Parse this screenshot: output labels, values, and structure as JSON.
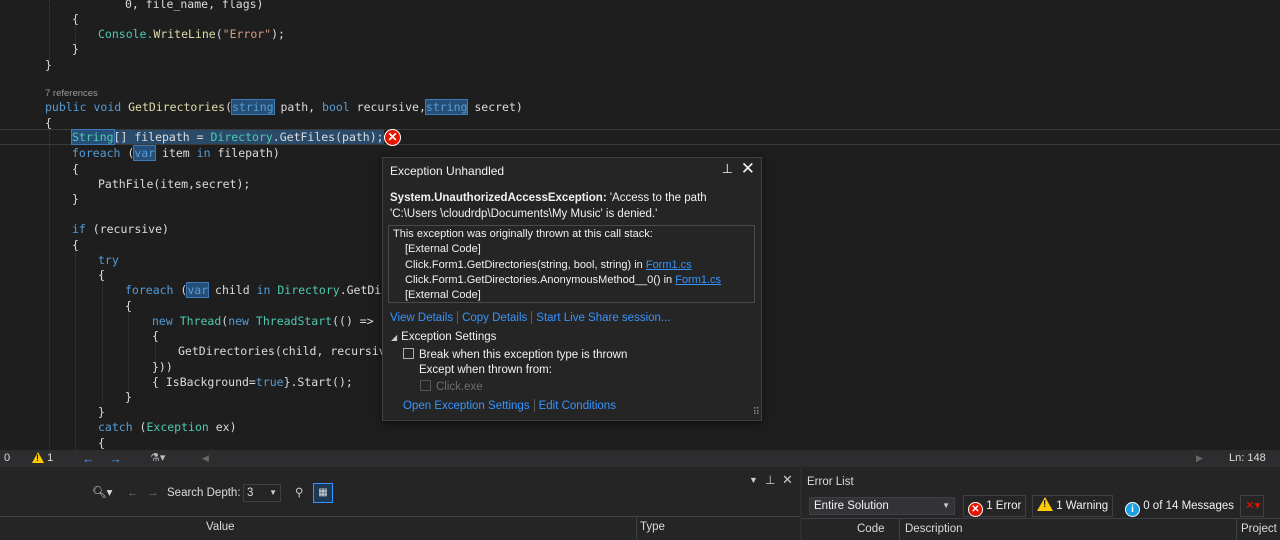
{
  "editor": {
    "lines": {
      "l0": "0, file_name, flags)",
      "brace_open1": "{",
      "console_call": "Console.",
      "console_method": "WriteLine",
      "console_arg": "\"Error\"",
      "console_end": ");",
      "brace_close1": "}",
      "brace_close2": "}",
      "refs": "7 references",
      "sig_public": "public",
      "sig_void": "void",
      "sig_name": "GetDirectories",
      "sig_p1type": "string",
      "sig_p1": " path, ",
      "sig_bool": "bool",
      "sig_p2": " recursive,",
      "sig_p3type": "string",
      "sig_p3": " secret)",
      "body_open": "{",
      "cur_type": "String",
      "cur_rest": "[] filepath = ",
      "cur_class": "Directory",
      "cur_call": ".GetFiles(path);",
      "foreach1_kw": "foreach",
      "foreach1_var": "var",
      "foreach1_rest": " item ",
      "foreach1_in": "in",
      "foreach1_end": " filepath)",
      "brace_open2": "{",
      "pathfile": "PathFile(item,secret);",
      "brace_close3": "}",
      "if_kw": "if",
      "if_rest": " (recursive)",
      "brace_open3": "{",
      "try_kw": "try",
      "brace_open4": "{",
      "foreach2_kw": "foreach",
      "foreach2_var": "var",
      "foreach2_rest": " child ",
      "foreach2_in": "in",
      "foreach2_class": " Directory",
      "foreach2_call": ".GetDir",
      "brace_open5": "{",
      "new_kw": "new",
      "thread": "Thread",
      "new2_kw": "new",
      "threadstart": "ThreadStart",
      "lambda": "(() =>",
      "brace_open6": "{",
      "getdir_call": "GetDirectories(child, recursiv",
      "close_lambda": "}))",
      "isbg_open": "{ IsBackground=",
      "isbg_true": "true",
      "isbg_end": "}.Start();",
      "brace_close4": "}",
      "brace_close5": "}",
      "catch_kw": "catch",
      "catch_type": "Exception",
      "catch_var": " ex",
      "catch_end": ")",
      "brace_open7": "{"
    }
  },
  "popup": {
    "title": "Exception Unhandled",
    "exception_type": "System.UnauthorizedAccessException:",
    "exception_message": " 'Access to the path 'C:\\Users \\cloudrdp\\Documents\\My Music' is denied.'",
    "callstack_header": "This exception was originally thrown at this call stack:",
    "frames": [
      {
        "text": "[External Code]",
        "link": ""
      },
      {
        "text": "Click.Form1.GetDirectories(string, bool, string) in ",
        "link": "Form1.cs"
      },
      {
        "text": "Click.Form1.GetDirectories.AnonymousMethod__0() in ",
        "link": "Form1.cs"
      },
      {
        "text": "[External Code]",
        "link": ""
      }
    ],
    "actions": {
      "view_details": "View Details",
      "copy_details": "Copy Details",
      "live_share": "Start Live Share session..."
    },
    "settings_header": "Exception Settings",
    "break_label": "Break when this exception type is thrown",
    "except_label": "Except when thrown from:",
    "module_label": "Click.exe",
    "open_settings": "Open Exception Settings",
    "edit_conditions": "Edit Conditions"
  },
  "statusbar": {
    "errors": "0",
    "warnings": "1",
    "line": "Ln: 148"
  },
  "watch": {
    "search_depth_label": "Search Depth:",
    "search_depth_value": "3",
    "col_value": "Value",
    "col_type": "Type"
  },
  "error_list": {
    "title": "Error List",
    "scope": "Entire Solution",
    "errors_btn": "1 Error",
    "warnings_btn": "1 Warning",
    "messages_btn": "0 of 14 Messages",
    "col_code": "Code",
    "col_description": "Description",
    "col_project": "Project"
  },
  "colors": {
    "editor_bg": "#1e1e1e",
    "keyword": "#569cd6",
    "type": "#4ec9b0",
    "string": "#d69d85",
    "error": "#e51400",
    "link": "#3794ff"
  }
}
